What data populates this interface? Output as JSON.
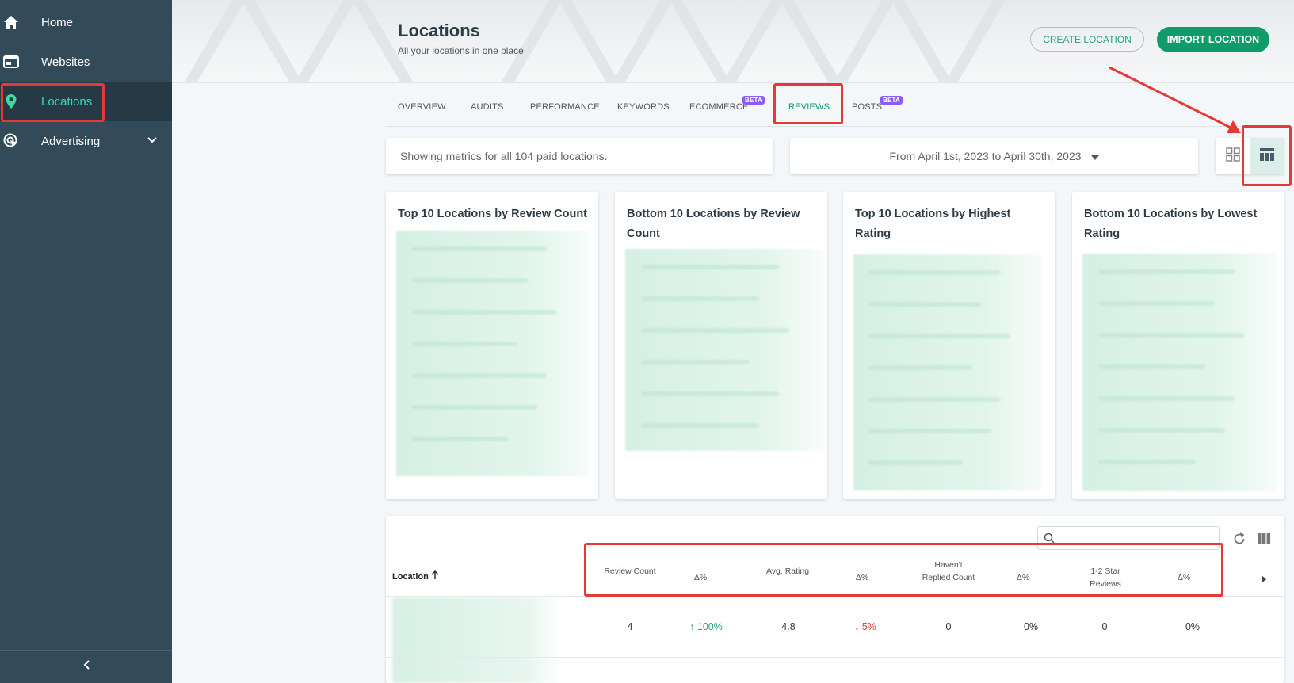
{
  "sidebar": {
    "items": [
      {
        "label": "Home",
        "icon": "home-icon"
      },
      {
        "label": "Websites",
        "icon": "browser-window-icon"
      },
      {
        "label": "Locations",
        "icon": "map-pin-icon"
      },
      {
        "label": "Advertising",
        "icon": "target-cursor-icon"
      }
    ]
  },
  "header": {
    "title": "Locations",
    "subtitle": "All your locations in one place",
    "create_label": "CREATE LOCATION",
    "import_label": "IMPORT LOCATION"
  },
  "tabs": [
    {
      "label": "OVERVIEW"
    },
    {
      "label": "AUDITS"
    },
    {
      "label": "PERFORMANCE"
    },
    {
      "label": "KEYWORDS"
    },
    {
      "label": "ECOMMERCE",
      "badge": "BETA"
    },
    {
      "label": "REVIEWS",
      "active": true
    },
    {
      "label": "POSTS",
      "badge": "BETA"
    }
  ],
  "metrics": {
    "summary": "Showing metrics for all 104 paid locations.",
    "date_range": "From April 1st, 2023 to April 30th, 2023"
  },
  "cards": [
    {
      "title": "Top 10 Locations by Review Count"
    },
    {
      "title": "Bottom 10 Locations by Review Count"
    },
    {
      "title": "Top 10 Locations by Highest Rating"
    },
    {
      "title": "Bottom 10 Locations by Lowest Rating"
    }
  ],
  "table": {
    "search_placeholder": "",
    "columns": {
      "location": "Location",
      "review_count": "Review Count",
      "delta1": "Δ%",
      "avg_rating": "Avg. Rating",
      "delta2": "Δ%",
      "havent_replied_1": "Haven't",
      "havent_replied_2": "Replied Count",
      "delta3": "Δ%",
      "star_reviews_1": "1-2 Star",
      "star_reviews_2": "Reviews",
      "delta4": "Δ%"
    },
    "rows": [
      {
        "review_count": "4",
        "delta1": "100%",
        "avg_rating": "4.8",
        "delta2": "5%",
        "havent_replied": "0",
        "delta3": "0%",
        "star_reviews": "0",
        "delta4": "0%"
      }
    ]
  },
  "colors": {
    "sidebar_bg": "#334a58",
    "accent": "#109b6b",
    "active_text": "#3fd9a6",
    "up": "#2aa57a",
    "down": "#e53b3b",
    "annotation": "#e53935",
    "beta": "#8b5cf6"
  }
}
